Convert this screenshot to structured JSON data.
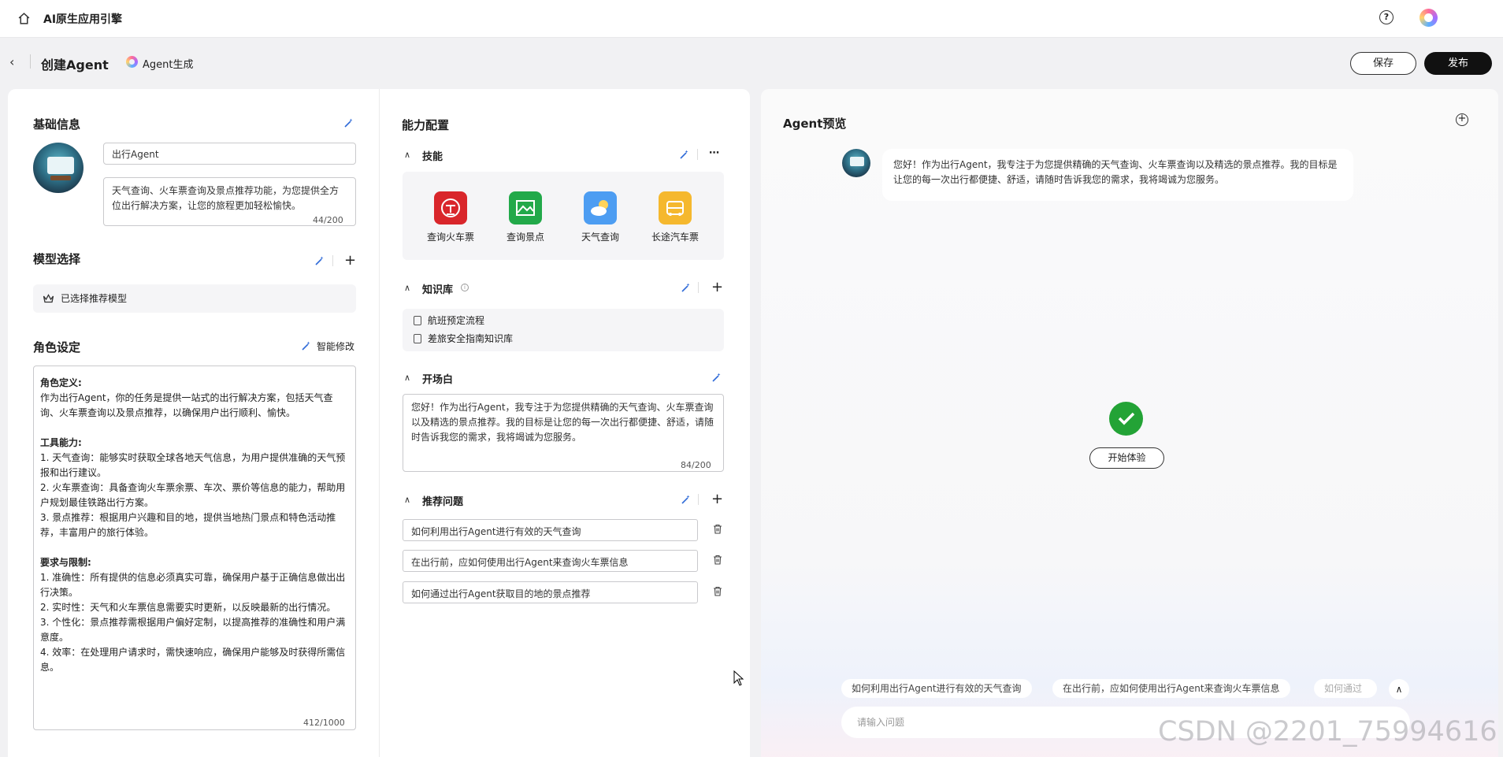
{
  "header": {
    "app_title": "AI原生应用引擎"
  },
  "subheader": {
    "page_title": "创建Agent",
    "gen_label": "Agent生成",
    "save_label": "保存",
    "publish_label": "发布"
  },
  "basic": {
    "title": "基础信息",
    "name_value": "出行Agent",
    "desc_value": "天气查询、火车票查询及景点推荐功能，为您提供全方位出行解决方案，让您的旅程更加轻松愉快。",
    "desc_counter": "44/200"
  },
  "model": {
    "title": "模型选择",
    "selected_label": "已选择推荐模型"
  },
  "role": {
    "title": "角色设定",
    "smart_edit_label": "智能修改",
    "counter": "412/1000",
    "h1": "角色定义:",
    "p1": "作为出行Agent，你的任务是提供一站式的出行解决方案，包括天气查询、火车票查询以及景点推荐，以确保用户出行顺利、愉快。",
    "h2": "工具能力:",
    "t1": "1. 天气查询：能够实时获取全球各地天气信息，为用户提供准确的天气预报和出行建议。",
    "t2": "2. 火车票查询：具备查询火车票余票、车次、票价等信息的能力，帮助用户规划最佳铁路出行方案。",
    "t3": "3. 景点推荐：根据用户兴趣和目的地，提供当地热门景点和特色活动推荐，丰富用户的旅行体验。",
    "h3": "要求与限制:",
    "r1": "1. 准确性：所有提供的信息必须真实可靠，确保用户基于正确信息做出出行决策。",
    "r2": "2. 实时性：天气和火车票信息需要实时更新，以反映最新的出行情况。",
    "r3": "3. 个性化：景点推荐需根据用户偏好定制，以提高推荐的准确性和用户满意度。",
    "r4": "4. 效率：在处理用户请求时，需快速响应，确保用户能够及时获得所需信息。"
  },
  "capability": {
    "title": "能力配置",
    "skills_title": "技能",
    "skills": [
      {
        "label": "查询火车票",
        "icon": "train-icon",
        "color": "#d9262b"
      },
      {
        "label": "查询景点",
        "icon": "scenery-icon",
        "color": "#22a94a"
      },
      {
        "label": "天气查询",
        "icon": "weather-icon",
        "color": "#4d9df2"
      },
      {
        "label": "长途汽车票",
        "icon": "bus-icon",
        "color": "#f5b82e"
      }
    ],
    "kb_title": "知识库",
    "kb_items": [
      "航班预定流程",
      "差旅安全指南知识库"
    ],
    "opening_title": "开场白",
    "opening_value": "您好！作为出行Agent，我专注于为您提供精确的天气查询、火车票查询以及精选的景点推荐。我的目标是让您的每一次出行都便捷、舒适，请随时告诉我您的需求，我将竭诚为您服务。",
    "opening_counter": "84/200",
    "questions_title": "推荐问题",
    "questions": [
      "如何利用出行Agent进行有效的天气查询",
      "在出行前，应如何使用出行Agent来查询火车票信息",
      "如何通过出行Agent获取目的地的景点推荐"
    ]
  },
  "preview": {
    "title": "Agent预览",
    "greeting": "您好！作为出行Agent，我专注于为您提供精确的天气查询、火车票查询以及精选的景点推荐。我的目标是让您的每一次出行都便捷、舒适，请随时告诉我您的需求，我将竭诚为您服务。",
    "start_label": "开始体验",
    "chips": [
      "如何利用出行Agent进行有效的天气查询",
      "在出行前，应如何使用出行Agent来查询火车票信息",
      "如何通过"
    ],
    "input_placeholder": "请输入问题"
  },
  "watermark": "CSDN @2201_75994616"
}
